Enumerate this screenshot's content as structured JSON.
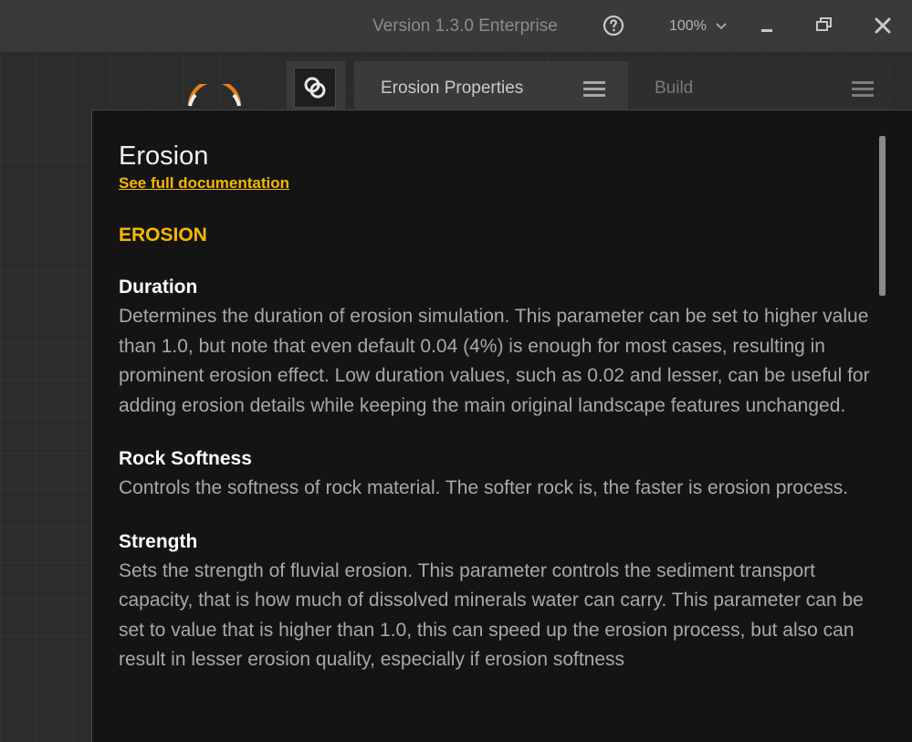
{
  "titlebar": {
    "version": "Version 1.3.0 Enterprise",
    "zoom": "100%",
    "icons": {
      "help": "help-circle-icon",
      "zoom_dropdown": "chevron-down-icon",
      "minimize": "minimize-icon",
      "restore": "restore-icon",
      "close": "close-icon"
    }
  },
  "tabs": [
    {
      "label": "Erosion Properties",
      "active": true,
      "icon": "hamburger-menu-icon"
    },
    {
      "label": "Build",
      "active": false,
      "icon": "hamburger-menu-icon"
    }
  ],
  "panel_icon": "link-node-icon",
  "doc": {
    "title": "Erosion",
    "link": "See full documentation",
    "section": "EROSION",
    "params": [
      {
        "name": "Duration",
        "description": "Determines the duration of erosion simulation. This parameter can be set to higher value than 1.0, but note that even default 0.04 (4%) is enough for most cases, resulting in prominent erosion effect. Low duration values, such as 0.02 and lesser, can be useful for adding erosion details while keeping the main original landscape features unchanged."
      },
      {
        "name": "Rock Softness",
        "description": "Controls the softness of rock material. The softer rock is, the faster is erosion process."
      },
      {
        "name": "Strength",
        "description": "Sets the strength of fluvial erosion. This parameter controls the sediment transport capacity, that is how much of dissolved minerals water can carry. This parameter can be set to value that is higher than 1.0, this can speed up the erosion process, but also can result in lesser erosion quality, especially if erosion softness"
      }
    ]
  },
  "colors": {
    "accent": "#f5b800",
    "node_ring": "#e8801a",
    "panel_bg": "#141414",
    "titlebar_bg": "#3a3a3a"
  }
}
